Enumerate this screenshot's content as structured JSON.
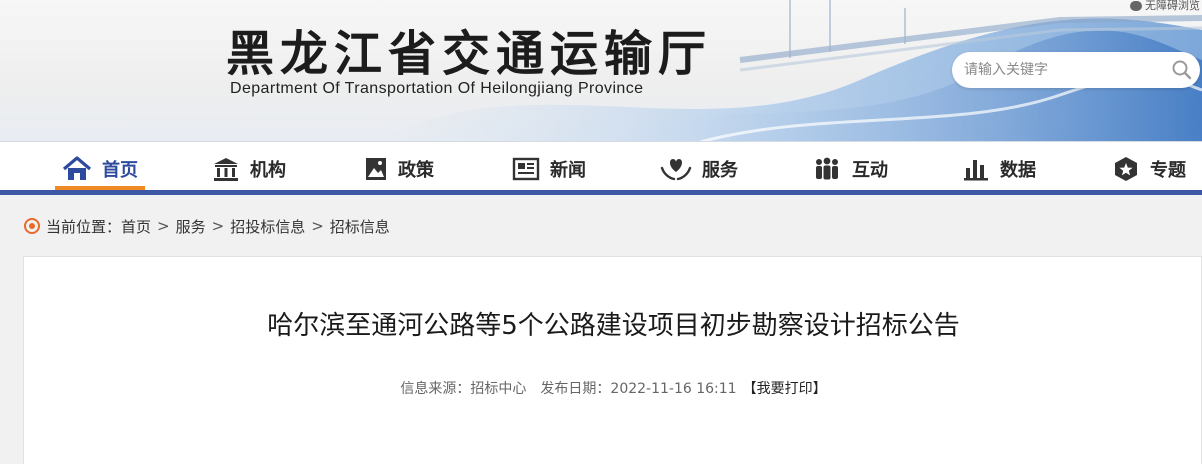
{
  "header": {
    "title": "黑龙江省交通运输厅",
    "subtitle": "Department Of Transportation Of Heilongjiang Province",
    "accessibility_label": "无障碍浏览",
    "search_placeholder": "请输入关键字"
  },
  "nav": {
    "items": [
      {
        "label": "首页",
        "icon": "home-icon",
        "active": true
      },
      {
        "label": "机构",
        "icon": "building-icon"
      },
      {
        "label": "政策",
        "icon": "picture-icon"
      },
      {
        "label": "新闻",
        "icon": "newspaper-icon"
      },
      {
        "label": "服务",
        "icon": "heart-hands-icon"
      },
      {
        "label": "互动",
        "icon": "people-icon"
      },
      {
        "label": "数据",
        "icon": "bar-chart-icon"
      },
      {
        "label": "专题",
        "icon": "star-badge-icon"
      }
    ],
    "colors": {
      "active_text": "#2d4a9e",
      "underline": "#3c57a6",
      "active_marker": "#f08a24"
    }
  },
  "breadcrumb": {
    "prefix": "当前位置：",
    "items": [
      "首页",
      "服务",
      "招投标信息",
      "招标信息"
    ],
    "separator": ">"
  },
  "article": {
    "title": "哈尔滨至通河公路等5个公路建设项目初步勘察设计招标公告",
    "source_label": "信息来源：",
    "source": "招标中心",
    "date_label": "发布日期：",
    "date": "2022-11-16 16:11",
    "print_label": "【我要打印】"
  }
}
